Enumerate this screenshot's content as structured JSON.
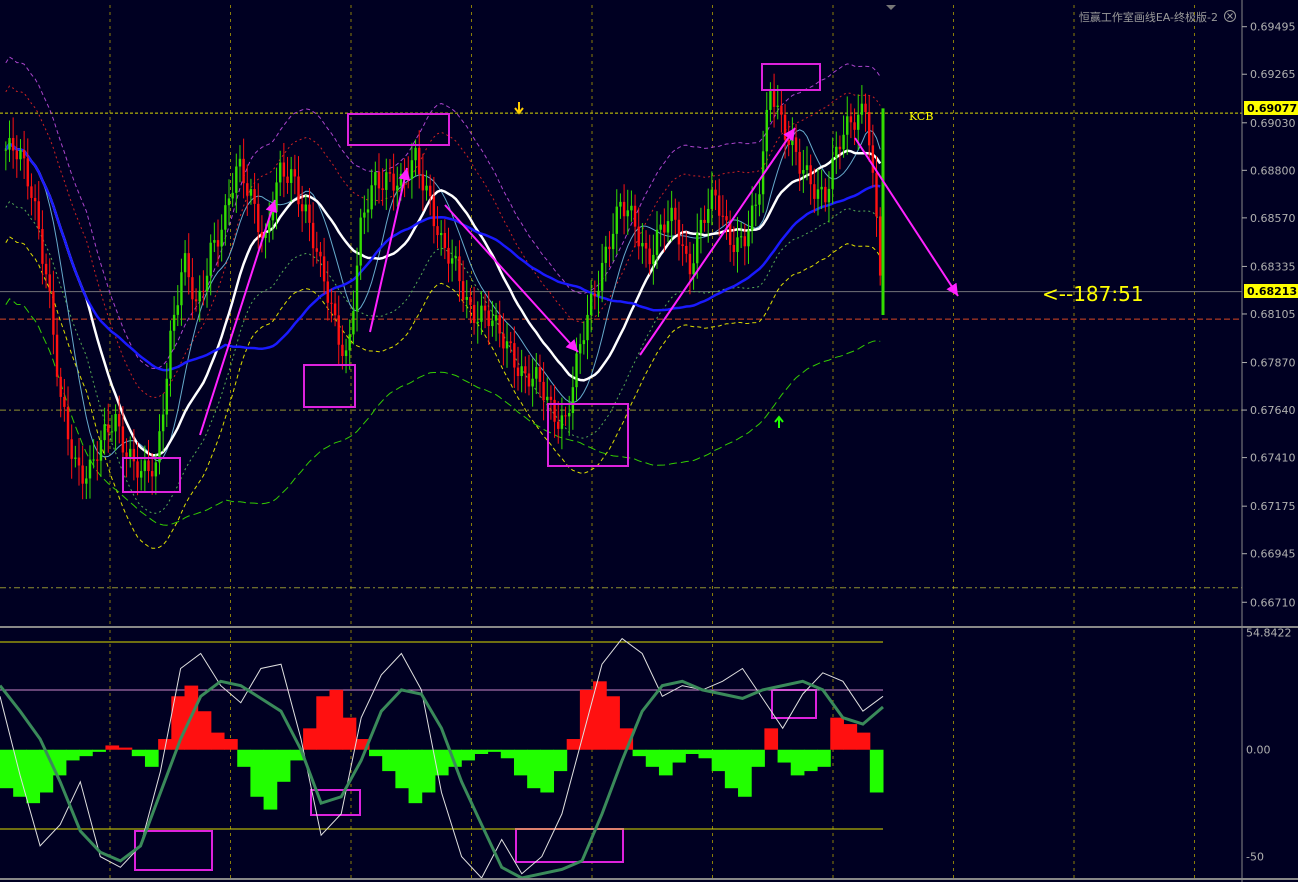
{
  "header": {
    "indicator_title": "恒赢工作室画线EA-终极版-2",
    "close_icon": "circle-x-icon"
  },
  "price_tags": {
    "current": "0.69077",
    "bid": "0.68213"
  },
  "labels": {
    "kcb": "KCB",
    "timer": "<--187:51"
  },
  "colors": {
    "background": "#000022",
    "grid": "#b8a800",
    "bull_candle": "#33dd00",
    "bear_candle": "#ff1111",
    "box": "#dd22dd",
    "arrow": "#ff22ff",
    "white_ma": "#ffffff",
    "blue_ma": "#1a1aff",
    "histo_pos": "#ff1010",
    "histo_neg": "#22ff00"
  },
  "chart_data": [
    {
      "type": "candlestick",
      "panel": "main",
      "y_tick_labels": [
        "0.69495",
        "0.69265",
        "0.69030",
        "0.68800",
        "0.68570",
        "0.68335",
        "0.68105",
        "0.67870",
        "0.67640",
        "0.67410",
        "0.67175",
        "0.66945",
        "0.66710"
      ],
      "ylim": [
        0.666,
        0.696
      ],
      "grid": true,
      "horizontal_levels": [
        0.69077,
        0.68213,
        0.6808,
        0.6764,
        0.6678
      ],
      "close_path": [
        0.689,
        0.6885,
        0.687,
        0.683,
        0.6765,
        0.674,
        0.6735,
        0.6745,
        0.676,
        0.6745,
        0.673,
        0.6735,
        0.68,
        0.6835,
        0.681,
        0.6845,
        0.6855,
        0.688,
        0.687,
        0.6845,
        0.6875,
        0.688,
        0.686,
        0.683,
        0.681,
        0.679,
        0.685,
        0.6875,
        0.688,
        0.687,
        0.6885,
        0.687,
        0.684,
        0.683,
        0.6815,
        0.681,
        0.68,
        0.6795,
        0.678,
        0.6775,
        0.6765,
        0.676,
        0.679,
        0.682,
        0.6845,
        0.686,
        0.6855,
        0.684,
        0.685,
        0.6855,
        0.6835,
        0.6855,
        0.6865,
        0.685,
        0.6845,
        0.686,
        0.6925,
        0.69,
        0.688,
        0.6875,
        0.687,
        0.689,
        0.6905,
        0.6915,
        0.683
      ]
    },
    {
      "type": "oscillator",
      "panel": "sub",
      "y_tick_labels": [
        "54.8422",
        "0.00",
        "-50"
      ],
      "ylim": [
        -60,
        56
      ],
      "histogram": [
        -18,
        -22,
        -25,
        -20,
        -12,
        -5,
        -3,
        -1,
        2,
        1,
        -3,
        -8,
        5,
        25,
        30,
        18,
        8,
        5,
        -8,
        -22,
        -28,
        -15,
        -5,
        10,
        25,
        28,
        15,
        5,
        -3,
        -10,
        -18,
        -25,
        -20,
        -12,
        -8,
        -5,
        -2,
        -1,
        -4,
        -12,
        -18,
        -20,
        -10,
        5,
        28,
        32,
        25,
        10,
        -3,
        -8,
        -12,
        -6,
        -2,
        -4,
        -10,
        -18,
        -22,
        -8,
        10,
        -6,
        -12,
        -10,
        -8,
        15,
        12,
        8,
        -20
      ],
      "signal": [
        30,
        18,
        5,
        -15,
        -38,
        -48,
        -52,
        -45,
        -20,
        5,
        25,
        32,
        30,
        24,
        18,
        0,
        -25,
        -22,
        -5,
        18,
        28,
        26,
        10,
        -15,
        -35,
        -55,
        -60,
        -58,
        -56,
        -52,
        -30,
        -5,
        18,
        30,
        32,
        28,
        26,
        24,
        28,
        30,
        32,
        28,
        15,
        12,
        20
      ],
      "fast": [
        25,
        -12,
        -45,
        -35,
        -15,
        -50,
        -55,
        -45,
        -10,
        38,
        45,
        30,
        22,
        38,
        40,
        5,
        -40,
        -30,
        15,
        35,
        45,
        28,
        -20,
        -50,
        -60,
        -42,
        -58,
        -50,
        -30,
        5,
        40,
        52,
        45,
        25,
        30,
        28,
        32,
        38,
        24,
        10,
        26,
        36,
        32,
        18,
        25
      ]
    }
  ]
}
